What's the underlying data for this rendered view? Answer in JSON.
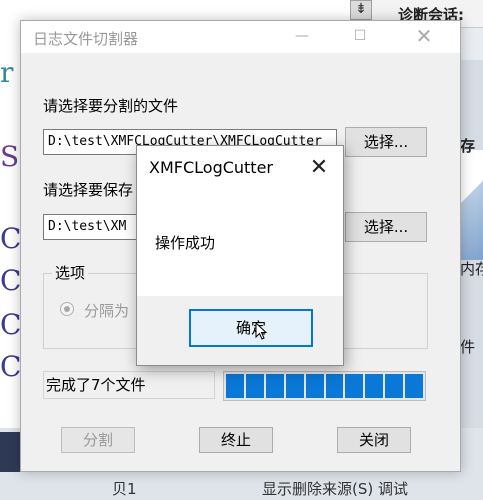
{
  "background": {
    "top_scroll_icon": "scroll-arrow-icon",
    "top_title": "诊断会话:",
    "right_text_1": "存",
    "right_text_2": "内存",
    "right_text_3": "件",
    "left_glyphs": [
      "r",
      "S",
      "C",
      "C",
      "C",
      "C"
    ],
    "bottom_text_1": "贝1",
    "bottom_text_2": "显示删除来源(S)   调试"
  },
  "main_window": {
    "title": "日志文件切割器",
    "minimize_icon": "minimize-icon",
    "maximize_icon": "maximize-icon",
    "close_icon": "close-icon",
    "source_label": "请选择要分割的文件",
    "source_path": "D:\\test\\XMFCLogCutter\\XMFCLogCutter",
    "source_browse": "选择...",
    "dest_label": "请选择要保存",
    "dest_path": "D:\\test\\XM",
    "dest_browse": "选择...",
    "options_legend": "选项",
    "radio_label": "分隔为",
    "status_text": "完成了7个文件",
    "progress_percent": 100,
    "split_button": "分割",
    "stop_button": "终止",
    "close_button": "关闭"
  },
  "message_box": {
    "title": "XMFCLogCutter",
    "close_icon": "close-icon",
    "message": "操作成功",
    "ok_button": "确定"
  },
  "colors": {
    "progress_fill": "#0a78d7",
    "focus_border": "#0078d7",
    "window_bg": "#f0f0f0"
  }
}
